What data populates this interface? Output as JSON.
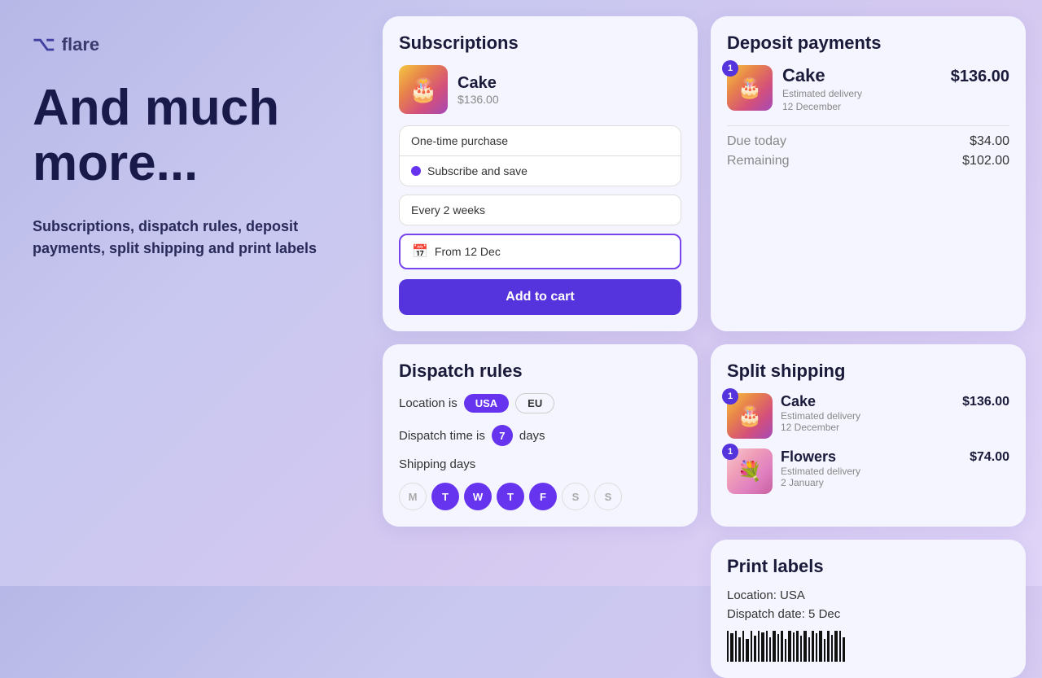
{
  "logo": {
    "icon": "⌥",
    "name": "flare"
  },
  "headline": "And much more...",
  "subtext": "Subscriptions, dispatch rules, deposit payments, split shipping and print labels",
  "subscriptions": {
    "title": "Subscriptions",
    "product": {
      "name": "Cake",
      "price": "$136.00",
      "emoji": "🎂"
    },
    "options": {
      "one_time": "One-time purchase",
      "subscribe": "Subscribe and save"
    },
    "frequency": "Every 2 weeks",
    "date": "From 12 Dec",
    "button": "Add to cart"
  },
  "deposit": {
    "title": "Deposit payments",
    "product": {
      "name": "Cake",
      "price": "$136.00",
      "delivery_label": "Estimated delivery",
      "delivery_date": "12 December",
      "badge": "1",
      "emoji": "🎂"
    },
    "due_today_label": "Due today",
    "due_today_value": "$34.00",
    "remaining_label": "Remaining",
    "remaining_value": "$102.00"
  },
  "dispatch": {
    "title": "Dispatch rules",
    "location_label": "Location is",
    "location_tags": [
      "USA",
      "EU"
    ],
    "dispatch_label": "Dispatch time is",
    "dispatch_days": "7",
    "dispatch_suffix": "days",
    "shipping_label": "Shipping days",
    "days": [
      {
        "label": "M",
        "active": false
      },
      {
        "label": "T",
        "active": true
      },
      {
        "label": "W",
        "active": true
      },
      {
        "label": "T",
        "active": true
      },
      {
        "label": "F",
        "active": true
      },
      {
        "label": "S",
        "active": false
      },
      {
        "label": "S",
        "active": false
      }
    ]
  },
  "split_shipping": {
    "title": "Split shipping",
    "items": [
      {
        "name": "Cake",
        "price": "$136.00",
        "delivery_label": "Estimated delivery",
        "delivery_date": "12 December",
        "badge": "1",
        "emoji": "🎂"
      },
      {
        "name": "Flowers",
        "price": "$74.00",
        "delivery_label": "Estimated delivery",
        "delivery_date": "2 January",
        "badge": "1",
        "emoji": "💐"
      }
    ]
  },
  "print_labels": {
    "title": "Print labels",
    "location": "Location: USA",
    "dispatch_date": "Dispatch date: 5 Dec"
  },
  "colors": {
    "accent": "#5533dd",
    "text_dark": "#1a1a3a"
  }
}
